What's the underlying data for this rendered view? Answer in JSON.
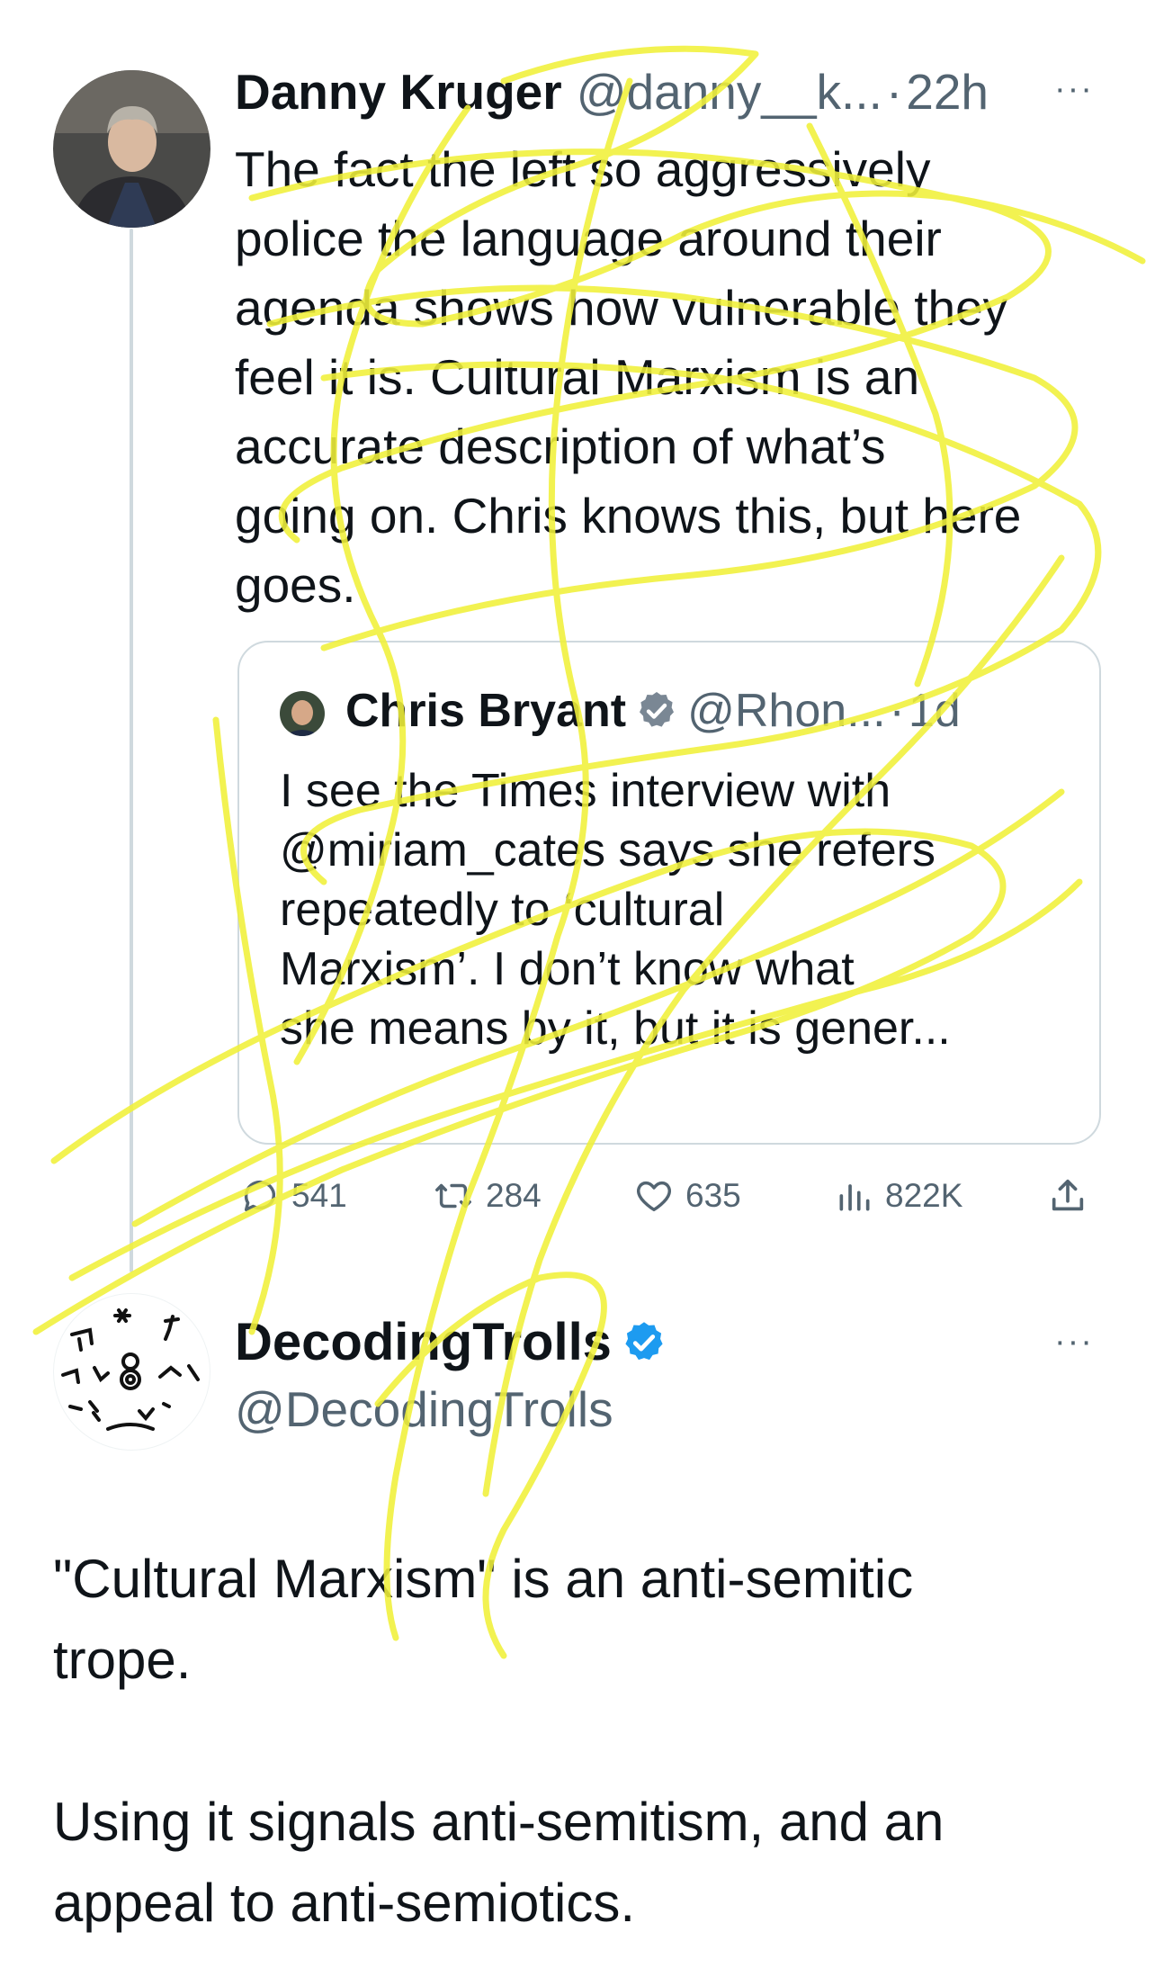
{
  "tweet1": {
    "display_name": "Danny Kruger",
    "handle": "@danny__k...",
    "separator": "·",
    "time": "22h",
    "more": "···",
    "text": "The fact the left so aggressively\npolice the language around their\nagenda shows how vulnerable they\nfeel it is. Cultural Marxism is an\naccurate description of what’s\ngoing on. Chris knows this, but here\ngoes.",
    "quote": {
      "display_name": "Chris Bryant",
      "handle": "@Rhon...",
      "separator": "·",
      "time": "1d",
      "text": "I see the Times interview with\n@miriam_cates says she refers\nrepeatedly to ‘cultural\nMarxism’. I don’t know what\nshe means by it, but it is gener..."
    },
    "actions": {
      "replies": "541",
      "retweets": "284",
      "likes": "635",
      "views": "822K"
    }
  },
  "tweet2": {
    "display_name": "DecodingTrolls",
    "handle": "@DecodingTrolls",
    "more": "···",
    "text": "\"Cultural Marxism\" is an anti-semitic\ntrope.\n\nUsing it signals anti-semitism, and an\nappeal to anti-semiotics."
  },
  "colors": {
    "text": "#0f1419",
    "secondary": "#536471",
    "verified": "#1d9bf0",
    "border": "#cfd9de",
    "scribble": "#f1f13a"
  },
  "icons": {
    "reply": "reply-icon",
    "retweet": "retweet-icon",
    "like": "heart-icon",
    "views": "views-icon",
    "share": "share-icon",
    "verified": "verified-badge-icon",
    "more": "more-icon"
  }
}
